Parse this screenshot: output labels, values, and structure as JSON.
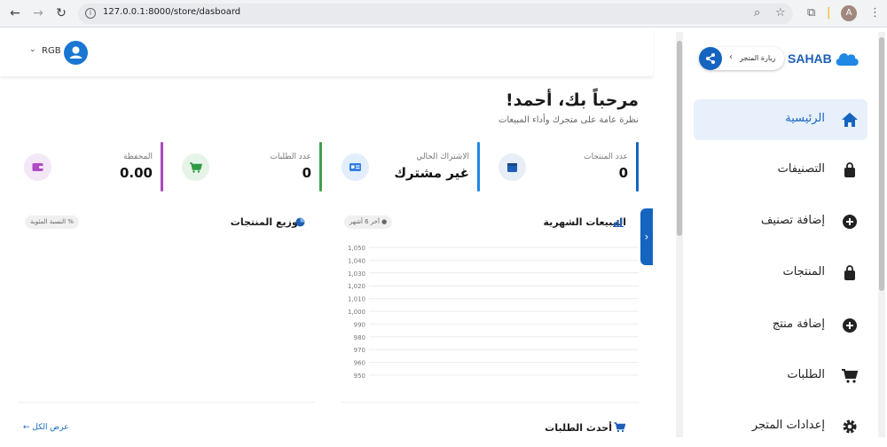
{
  "browser": {
    "url": "127.0.0.1:8000/store/dasboard",
    "profile_initial": "A"
  },
  "header": {
    "user_name": "RGB"
  },
  "welcome": {
    "title": "مرحباً بك، أحمد!",
    "subtitle": "نظرة عامة على متجرك وأداء المبيعات"
  },
  "stats": [
    {
      "label": "عدد المنتجات",
      "value": "0",
      "accent": "#1565c0",
      "icon": "box-icon"
    },
    {
      "label": "الاشتراك الحالي",
      "value": "غير مشترك",
      "accent": "#1e88e5",
      "icon": "id-card-icon"
    },
    {
      "label": "عدد الطلبات",
      "value": "0",
      "accent": "#43a047",
      "icon": "cart-icon"
    },
    {
      "label": "المحفظة",
      "value": "0.00",
      "accent": "#ab47bc",
      "icon": "wallet-icon"
    }
  ],
  "sales_panel": {
    "title": "المبيعات الشهرية",
    "pill": "آخر 6 أشهر"
  },
  "distribution_panel": {
    "title": "توزيع المنتجات",
    "pill": "النسبة المئوية"
  },
  "orders_panel": {
    "title": "أحدث الطلبات",
    "view_all": "عرض الكل"
  },
  "chart_data": {
    "type": "line",
    "title": "المبيعات الشهرية",
    "ylim": [
      950,
      1050
    ],
    "yticks": [
      "1,050",
      "1,040",
      "1,030",
      "1,020",
      "1,010",
      "1,000",
      "990",
      "980",
      "970",
      "960",
      "950"
    ],
    "series": []
  },
  "sidebar": {
    "brand": "SAHAB",
    "visit_store": "زيارة المتجر",
    "items": [
      {
        "label": "الرئيسية",
        "icon": "home-icon",
        "active": true
      },
      {
        "label": "التصنيفات",
        "icon": "bag-icon",
        "active": false
      },
      {
        "label": "إضافة تصنيف",
        "icon": "plus-circle-icon",
        "active": false
      },
      {
        "label": "المنتجات",
        "icon": "bag-icon",
        "active": false
      },
      {
        "label": "إضافة منتج",
        "icon": "plus-circle-icon",
        "active": false
      },
      {
        "label": "الطلبات",
        "icon": "cart-icon",
        "active": false
      },
      {
        "label": "إعدادات المتجر",
        "icon": "gear-icon",
        "active": false
      }
    ]
  },
  "colors": {
    "primary": "#1565c0",
    "active_bg": "#e8f0fb"
  }
}
